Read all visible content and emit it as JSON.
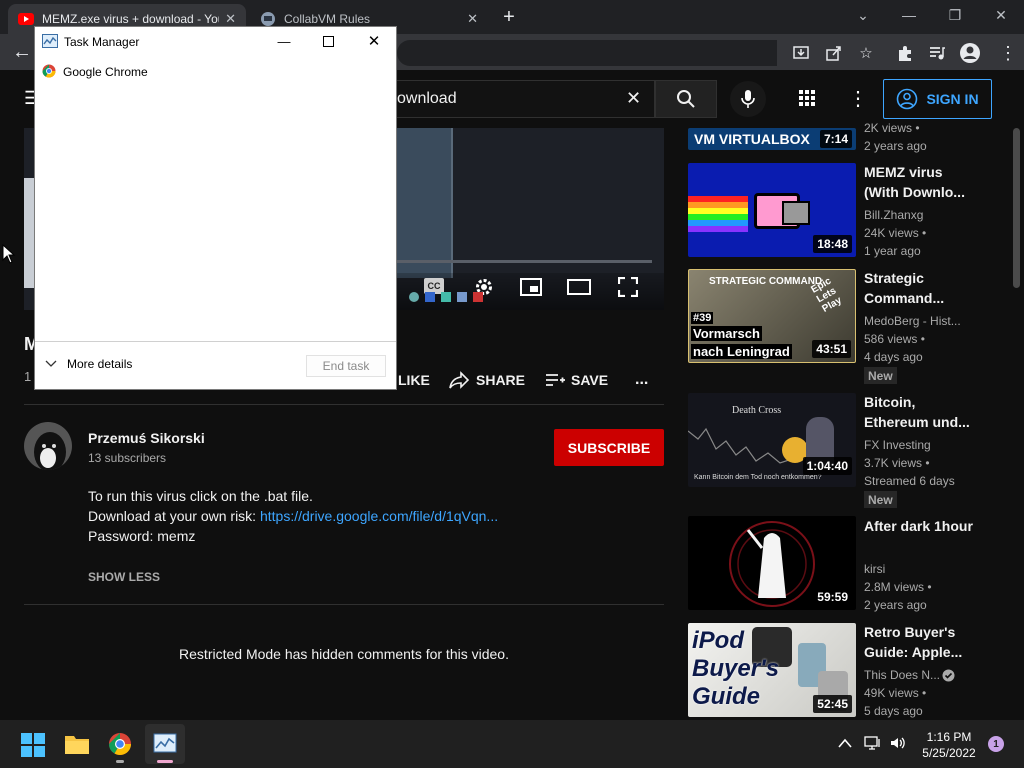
{
  "browser": {
    "tabs": [
      {
        "title": "MEMZ.exe virus + download - YouTube",
        "active": true
      },
      {
        "title": "CollabVM Rules",
        "active": false
      }
    ],
    "new_tab": "+"
  },
  "youtube": {
    "search_value": "ownload",
    "sign_in_label": "SIGN IN",
    "video_title_fragment": "M",
    "views_fragment": "1",
    "actions": {
      "like": "LIKE",
      "share": "SHARE",
      "save": "SAVE",
      "more": "..."
    },
    "channel": {
      "name": "Przemuś Sikorski",
      "subscribers": "13 subscribers",
      "subscribe_label": "SUBSCRIBE"
    },
    "description": {
      "line1": "To run this virus click on the .bat file.",
      "line2_prefix": "Download at your own risk: ",
      "line2_link": "https://drive.google.com/file/d/1qVqn...",
      "line3": "Password: memz"
    },
    "show_less": "SHOW LESS",
    "comments_notice": "Restricted Mode has hidden comments for this video.",
    "thumbnail_text": {
      "vbox": "VM VIRTUALBOX",
      "strategic_header": "STRATEGIC COMMAND",
      "epic": "Epic Lets Play",
      "episode": "#39",
      "vormarsch": "Vormarsch",
      "leningrad": "nach Leningrad",
      "death_cross": "Death Cross",
      "death_cross_sub": "Kann Bitcoin dem Tod noch entkommen?",
      "ipod1": "iPod",
      "ipod2": "Buyer's",
      "ipod3": "Guide"
    },
    "sidebar": [
      {
        "title": "",
        "channel": "",
        "views": "2K views •",
        "age": "2 years ago",
        "duration": "7:14"
      },
      {
        "title": "MEMZ virus (With Downlo...",
        "channel": "Bill.Zhanxg",
        "views": "24K views •",
        "age": "1 year ago",
        "duration": "18:48"
      },
      {
        "title": "Strategic Command...",
        "channel": "MedoBerg - Hist...",
        "views": "586 views •",
        "age": "4 days ago",
        "duration": "43:51",
        "badge": "New"
      },
      {
        "title": "Bitcoin, Ethereum und...",
        "channel": "FX Investing",
        "views": "3.7K views •",
        "age": "Streamed 6 days",
        "duration": "1:04:40",
        "badge": "New"
      },
      {
        "title": "After dark 1hour",
        "channel": "kirsi",
        "views": "2.8M views •",
        "age": "2 years ago",
        "duration": "59:59"
      },
      {
        "title": "Retro Buyer's Guide: Apple...",
        "channel": "This Does N...",
        "views": "49K views •",
        "age": "5 days ago",
        "duration": "52:45"
      }
    ],
    "player_controls": {
      "cc": "CC"
    }
  },
  "task_manager": {
    "title": "Task Manager",
    "process": "Google Chrome",
    "more_details": "More details",
    "end_task": "End task"
  },
  "taskbar": {
    "time": "1:16 PM",
    "date": "5/25/2022",
    "notifications": "1"
  },
  "colors": {
    "subscribe": "#cc0000",
    "link": "#3ea6ff",
    "accent": "#3ea6ff"
  }
}
